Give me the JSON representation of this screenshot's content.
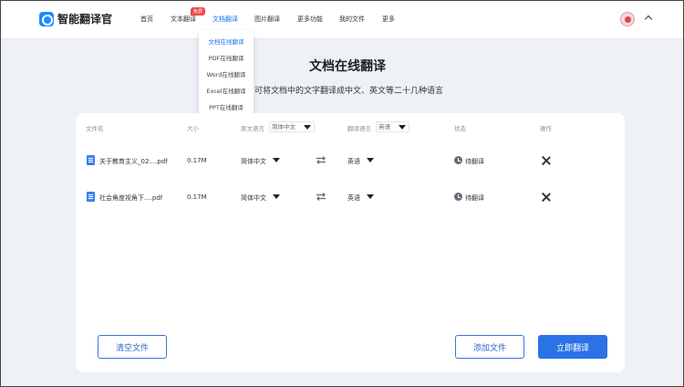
{
  "header": {
    "logo_text": "智能翻译官",
    "nav": [
      {
        "label": "首页"
      },
      {
        "label": "文本翻译"
      },
      {
        "label": "文档翻译"
      },
      {
        "label": "图片翻译"
      },
      {
        "label": "更多功能"
      },
      {
        "label": "我的文件"
      },
      {
        "label": "更多"
      }
    ],
    "free_badge": "免费"
  },
  "dropdown": {
    "items": [
      {
        "label": "文档在线翻译"
      },
      {
        "label": "PDF在线翻译"
      },
      {
        "label": "Word在线翻译"
      },
      {
        "label": "Excel在线翻译"
      },
      {
        "label": "PPT在线翻译"
      }
    ]
  },
  "main": {
    "title": "文档在线翻译",
    "subtitle": "可将文档中的文字翻译成中文、英文等二十几种语言"
  },
  "table": {
    "headers": {
      "file_name": "文件名",
      "size": "大小",
      "source_lang": "原文语言",
      "target_lang": "翻译语言",
      "status": "状态",
      "actions": "操作"
    },
    "source_lang_select": "简体中文",
    "target_lang_select": "英语",
    "rows": [
      {
        "name": "关于教育主义_02....pdf",
        "size": "0.17M",
        "source": "简体中文",
        "target": "英语",
        "status": "待翻译"
      },
      {
        "name": "社会角度视角下....pdf",
        "size": "0.17M",
        "source": "简体中文",
        "target": "英语",
        "status": "待翻译"
      }
    ]
  },
  "buttons": {
    "clear": "清空文件",
    "add": "添加文件",
    "translate": "立即翻译"
  },
  "colors": {
    "accent": "#2a72e6",
    "badge": "#f04848"
  }
}
